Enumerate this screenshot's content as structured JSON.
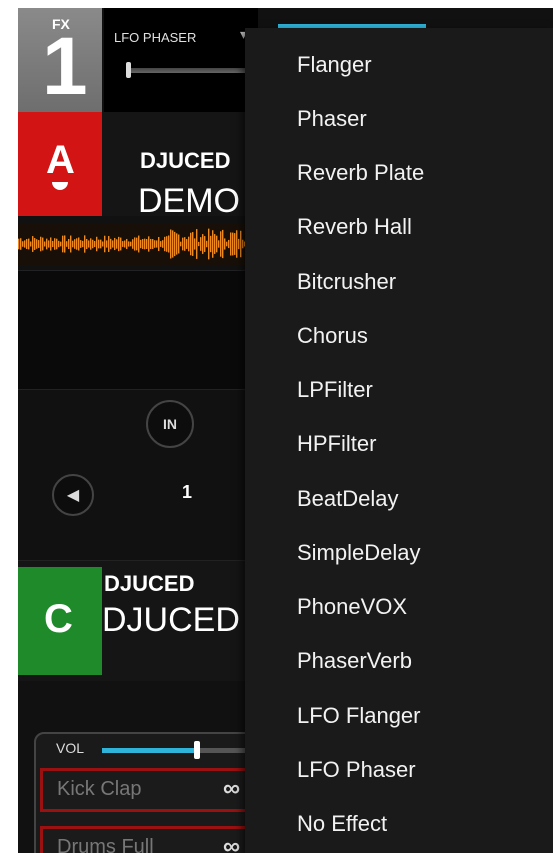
{
  "fx": {
    "label": "FX",
    "number": "1",
    "slot1_name": "LFO PHASER",
    "dropdown_glyph": "▾"
  },
  "deck_a": {
    "letter": "A",
    "artist": "DJUCED",
    "title": "DEMO"
  },
  "loop": {
    "in_label": "IN",
    "prev_glyph": "◀",
    "size": "1"
  },
  "deck_c": {
    "letter": "C",
    "artist": "DJUCED",
    "title": "DJUCED"
  },
  "sampler": {
    "vol_label": "VOL",
    "volume_level": 0.63,
    "pads": [
      {
        "name": "Kick Clap",
        "loop_symbol": "∞"
      },
      {
        "name": "Drums Full",
        "loop_symbol": "∞"
      }
    ]
  },
  "menu": {
    "items": [
      "Flanger",
      "Phaser",
      "Reverb Plate",
      "Reverb Hall",
      "Bitcrusher",
      "Chorus",
      "LPFilter",
      "HPFilter",
      "BeatDelay",
      "SimpleDelay",
      "PhoneVOX",
      "PhaserVerb",
      "LFO Flanger",
      "LFO Phaser",
      "No Effect"
    ]
  },
  "colors": {
    "deck_a": "#d21414",
    "deck_c": "#1e8a2a",
    "accent": "#2fb3d8",
    "waveform": "#f08a1a"
  }
}
